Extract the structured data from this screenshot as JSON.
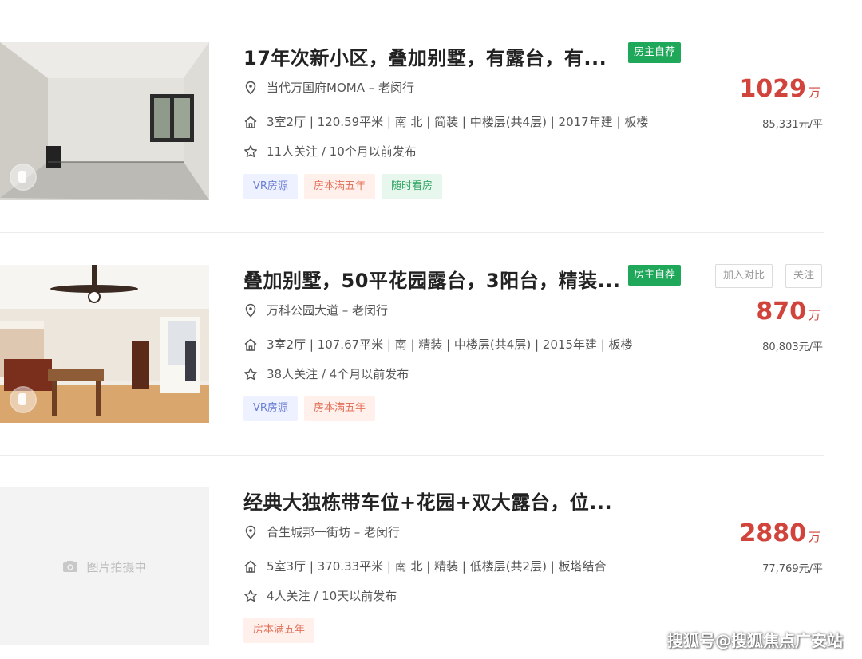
{
  "listings": [
    {
      "title": "17年次新小区，叠加别墅，有露台，有...",
      "owner_tag": "房主自荐",
      "location": "当代万国府MOMA – 老闵行",
      "specs": "3室2厅 | 120.59平米 | 南 北 | 简装 | 中楼层(共4层) | 2017年建 | 板楼",
      "follow": "11人关注 / 10个月以前发布",
      "tags": [
        "VR房源",
        "房本满五年",
        "随时看房"
      ],
      "price": "1029",
      "price_unit": "万",
      "unit_price": "85,331元/平"
    },
    {
      "title": "叠加别墅，50平花园露台，3阳台，精装...",
      "owner_tag": "房主自荐",
      "location": "万科公园大道 – 老闵行",
      "specs": "3室2厅 | 107.67平米 | 南 | 精装 | 中楼层(共4层) | 2015年建 | 板楼",
      "follow": "38人关注 / 4个月以前发布",
      "tags": [
        "VR房源",
        "房本满五年"
      ],
      "price": "870",
      "price_unit": "万",
      "unit_price": "80,803元/平",
      "compare_button": "加入对比",
      "follow_button": "关注"
    },
    {
      "title": "经典大独栋带车位+花园+双大露台，位...",
      "location": "合生城邦一街坊 – 老闵行",
      "specs": "5室3厅 | 370.33平米 | 南 北 | 精装 | 低楼层(共2层) | 板塔结合",
      "follow": "4人关注 / 10天以前发布",
      "tags": [
        "房本满五年"
      ],
      "price": "2880",
      "price_unit": "万",
      "unit_price": "77,769元/平",
      "image_placeholder": "图片拍摄中"
    }
  ],
  "watermark": "搜狐号@搜狐焦点广安站",
  "colors": {
    "price": "#d1443c",
    "owner_tag": "#1fa85a"
  }
}
